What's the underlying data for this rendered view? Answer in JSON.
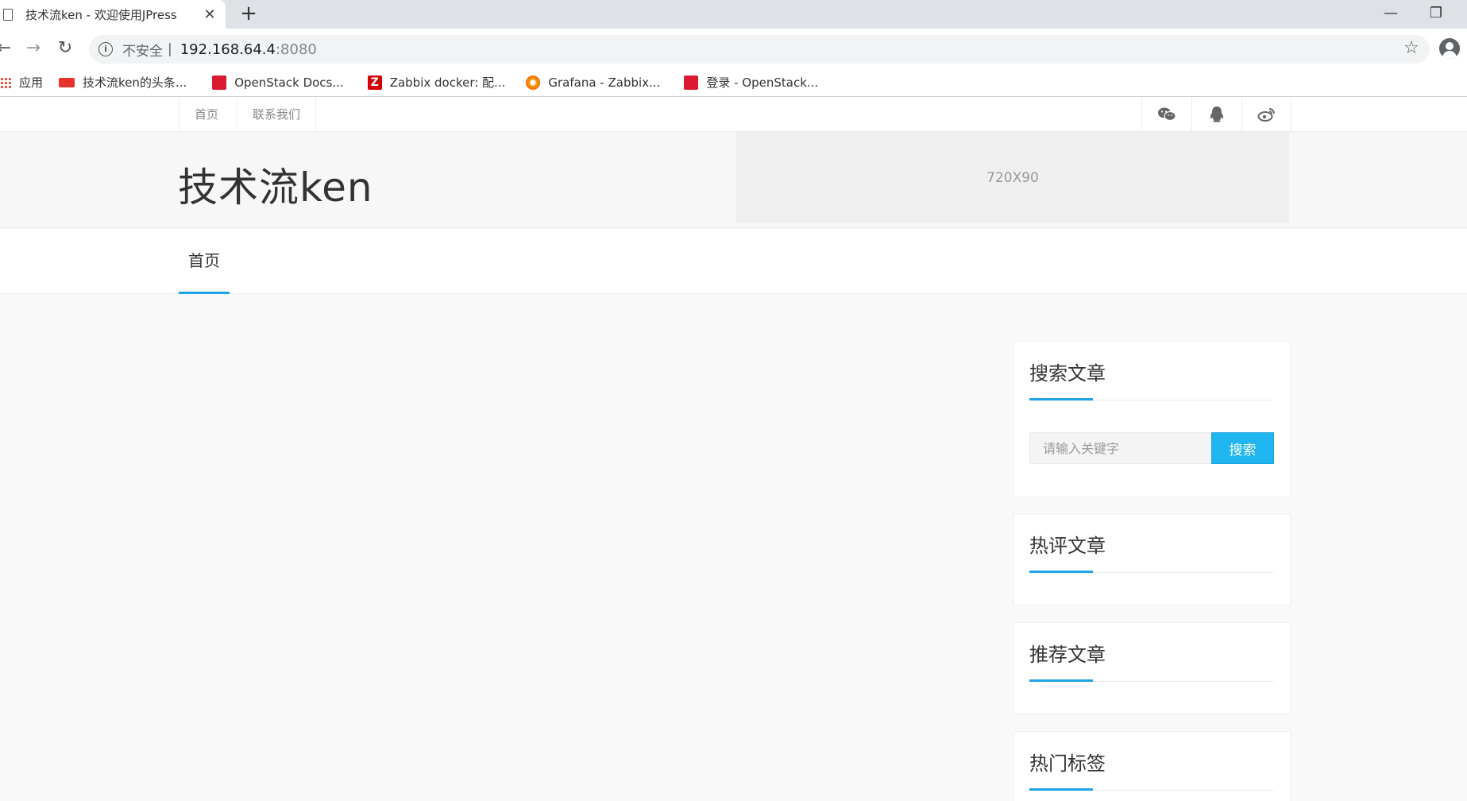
{
  "browser": {
    "tab_title": "技术流ken - 欢迎使用JPress",
    "tab_close": "✕",
    "new_tab": "+",
    "minimize": "—",
    "restore": "❐",
    "back": "←",
    "forward": "→",
    "reload": "↻",
    "info": "i",
    "insecure_label": "不安全",
    "separator": "|",
    "url_host": "192.168.64.4",
    "url_port": ":8080",
    "star": "☆"
  },
  "bookmarks": [
    {
      "label": "应用",
      "icon": "apps-grid-icon"
    },
    {
      "label": "技术流ken的头条...",
      "icon": "toutiao-icon",
      "color": "#e5322d"
    },
    {
      "label": "OpenStack Docs...",
      "icon": "openstack-icon",
      "color": "#da1a32"
    },
    {
      "label": "Zabbix docker: 配...",
      "icon": "zabbix-icon",
      "color": "#d40000"
    },
    {
      "label": "Grafana - Zabbix...",
      "icon": "grafana-icon",
      "color": "#f7a21b"
    },
    {
      "label": "登录 - OpenStack...",
      "icon": "openstack-icon",
      "color": "#da1a32"
    }
  ],
  "site": {
    "top_links": [
      "首页",
      "联系我们"
    ],
    "social_icons": [
      "wechat-icon",
      "qq-icon",
      "weibo-icon"
    ],
    "logo": "技术流ken",
    "ad_text": "720X90",
    "nav": [
      "首页"
    ]
  },
  "sidebar": {
    "search": {
      "title": "搜索文章",
      "placeholder": "请输入关键字",
      "button": "搜索"
    },
    "hot_comment": {
      "title": "热评文章"
    },
    "recommended": {
      "title": "推荐文章"
    },
    "hot_tags": {
      "title": "热门标签"
    }
  },
  "colors": {
    "accent": "#1fa3e6",
    "search_button": "#1fb5f0"
  }
}
